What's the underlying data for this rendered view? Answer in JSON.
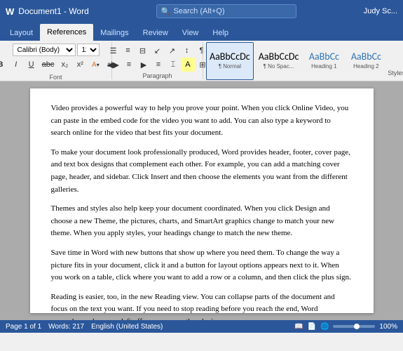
{
  "titleBar": {
    "appIcon": "W",
    "docTitle": "Document1 - Word",
    "search": {
      "placeholder": "Search (Alt+Q)"
    },
    "user": "Judy Sc..."
  },
  "tabs": [
    {
      "id": "layout",
      "label": "Layout"
    },
    {
      "id": "references",
      "label": "References",
      "active": true
    },
    {
      "id": "mailings",
      "label": "Mailings"
    },
    {
      "id": "review",
      "label": "Review"
    },
    {
      "id": "view",
      "label": "View"
    },
    {
      "id": "help",
      "label": "Help"
    }
  ],
  "ribbon": {
    "paragraph": {
      "label": "Paragraph",
      "buttons_row1": [
        "☰",
        "≡",
        "⊟",
        "↕",
        "⇅",
        "¶"
      ],
      "buttons_row2": [
        "◀▶",
        "◀≡",
        "▶≡",
        "⌶",
        "≋",
        "⊞"
      ]
    },
    "styles": {
      "label": "Styles",
      "items": [
        {
          "id": "normal",
          "name": "¶ Normal",
          "label": "Normal",
          "active": true
        },
        {
          "id": "no-spacing",
          "name": "¶ No Spac...",
          "label": "No Spac..."
        },
        {
          "id": "heading1",
          "name": "Heading 1",
          "label": "Heading 1"
        },
        {
          "id": "heading2",
          "name": "Heading 2",
          "label": "Heading 2"
        }
      ]
    }
  },
  "document": {
    "paragraphs": [
      "Video provides a powerful way to help you prove your point. When you click Online Video, you can paste in the embed code for the video you want to add. You can also type a keyword to search online for the video that best fits your document.",
      "To make your document look professionally produced, Word provides header, footer, cover page, and text box designs that complement each other. For example, you can add a matching cover page, header, and sidebar. Click Insert and then choose the elements you want from the different galleries.",
      "Themes and styles also help keep your document coordinated. When you click Design and choose a new Theme, the pictures, charts, and SmartArt graphics change to match your new theme. When you apply styles, your headings change to match the new theme.",
      "Save time in Word with new buttons that show up where you need them. To change the way a picture fits in your document, click it and a button for layout options appears next to it. When you work on a table, click where you want to add a row or a column, and then click the plus sign.",
      "Reading is easier, too, in the new Reading view. You can collapse parts of the document and focus on the text you want. If you need to stop reading before you reach the end, Word remembers where you left off - even on another device."
    ]
  },
  "statusBar": {
    "wordCount": "Words: 217",
    "language": "English (United States)",
    "zoom": "100%"
  }
}
